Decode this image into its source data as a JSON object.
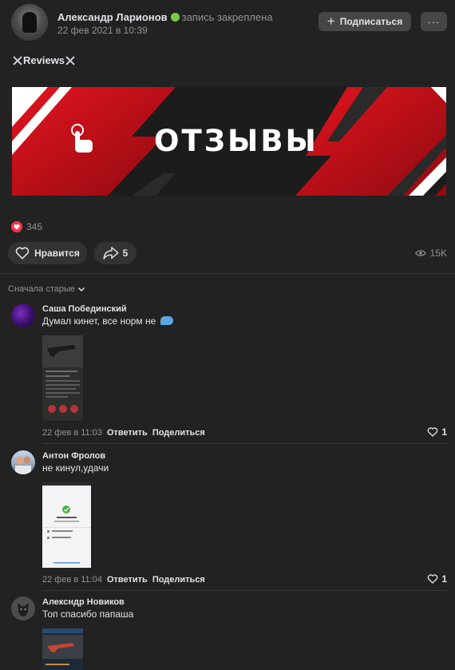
{
  "post": {
    "author": "Александр Ларионов",
    "pinned": "запись закреплена",
    "date": "22 фев 2021 в 10:39",
    "subscribe_label": "Подписаться",
    "more_label": "···",
    "text": "Reviews",
    "banner_text": "ОТЗЫВЫ",
    "likes_count": "345",
    "like_label": "Нравится",
    "shares_count": "5",
    "views": "15K",
    "banner_colors": {
      "red": "#c8101b",
      "dark": "#1c1c1c",
      "white": "#ffffff"
    }
  },
  "comments_sort": "Сначала старые",
  "comments": [
    {
      "author": "Саша Побединский",
      "text": "Думал кинет, все норм не",
      "date": "22 фев в 11:03",
      "reply_label": "Ответить",
      "share_label": "Поделиться",
      "likes": "1"
    },
    {
      "author": "Антон Фролов",
      "text": "не кинул,удачи",
      "date": "22 фев в 11:04",
      "reply_label": "Ответить",
      "share_label": "Поделиться",
      "likes": "1"
    },
    {
      "author": "Алексндр Новиков",
      "text": "Топ спасибо папаша"
    }
  ]
}
